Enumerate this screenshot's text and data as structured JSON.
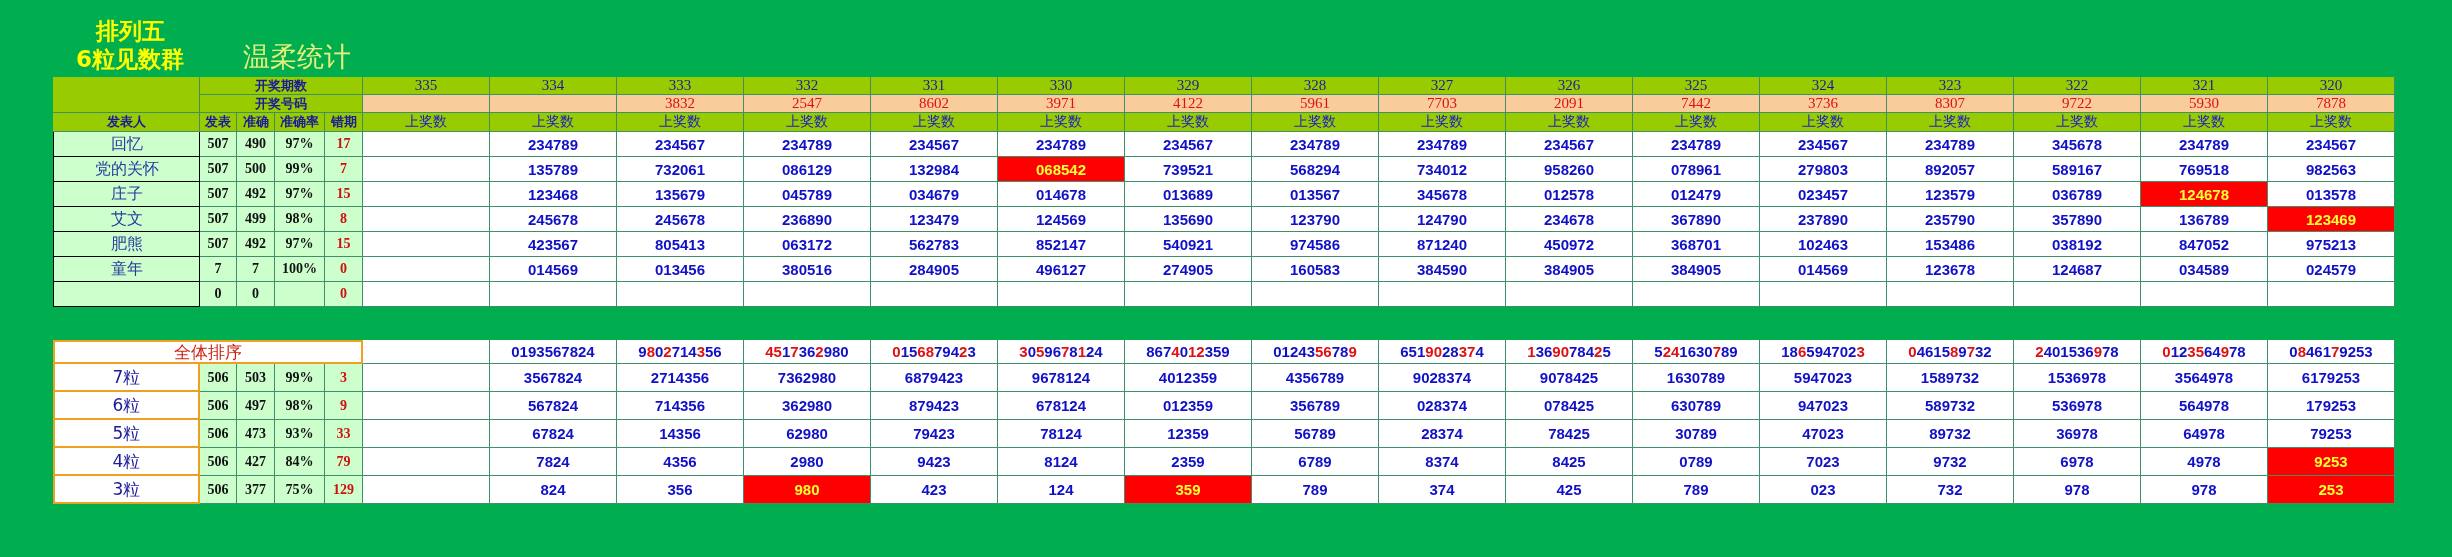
{
  "title": "排列五",
  "subtitle": "6粒见数群",
  "caption": "温柔统计",
  "header": {
    "period_label": "开奖期数",
    "draw_label": "开奖号码",
    "columns": [
      "发表人",
      "发表",
      "准确",
      "准确率",
      "错期"
    ]
  },
  "periods": [
    {
      "period": "335",
      "label": "上奖数"
    },
    {
      "period": "334",
      "label": "上奖数"
    },
    {
      "period": "333",
      "draw": "3832",
      "label": "上奖数"
    },
    {
      "period": "332",
      "draw": "2547",
      "label": "上奖数"
    },
    {
      "period": "331",
      "draw": "8602",
      "label": "上奖数"
    },
    {
      "period": "330",
      "draw": "3971",
      "label": "上奖数"
    },
    {
      "period": "329",
      "draw": "4122",
      "label": "上奖数"
    },
    {
      "period": "328",
      "draw": "5961",
      "label": "上奖数"
    },
    {
      "period": "327",
      "draw": "7703",
      "label": "上奖数"
    },
    {
      "period": "326",
      "draw": "2091",
      "label": "上奖数"
    },
    {
      "period": "325",
      "draw": "7442",
      "label": "上奖数"
    },
    {
      "period": "324",
      "draw": "3736",
      "label": "上奖数"
    },
    {
      "period": "323",
      "draw": "8307",
      "label": "上奖数"
    },
    {
      "period": "322",
      "draw": "9722",
      "label": "上奖数"
    },
    {
      "period": "321",
      "draw": "5930",
      "label": "上奖数"
    },
    {
      "period": "320",
      "draw": "7878",
      "label": "上奖数"
    }
  ],
  "experts": [
    {
      "name": "回忆",
      "posted": "507",
      "correct": "490",
      "rate": "97%",
      "misses": "17",
      "cells": [
        null,
        {
          "value": "234789",
          "miss": false
        },
        {
          "value": "234567",
          "miss": false
        },
        {
          "value": "234789",
          "miss": false
        },
        {
          "value": "234567",
          "miss": false
        },
        {
          "value": "234789",
          "miss": false
        },
        {
          "value": "234567",
          "miss": false
        },
        {
          "value": "234789",
          "miss": false
        },
        {
          "value": "234789",
          "miss": false
        },
        {
          "value": "234567",
          "miss": false
        },
        {
          "value": "234789",
          "miss": false
        },
        {
          "value": "234567",
          "miss": false
        },
        {
          "value": "234789",
          "miss": false
        },
        {
          "value": "345678",
          "miss": false
        },
        {
          "value": "234789",
          "miss": false
        },
        {
          "value": "234567",
          "miss": false
        }
      ]
    },
    {
      "name": "党的关怀",
      "posted": "507",
      "correct": "500",
      "rate": "99%",
      "misses": "7",
      "cells": [
        null,
        {
          "value": "135789",
          "miss": false
        },
        {
          "value": "732061",
          "miss": false
        },
        {
          "value": "086129",
          "miss": false
        },
        {
          "value": "132984",
          "miss": false
        },
        {
          "value": "068542",
          "miss": true
        },
        {
          "value": "739521",
          "miss": false
        },
        {
          "value": "568294",
          "miss": false
        },
        {
          "value": "734012",
          "miss": false
        },
        {
          "value": "958260",
          "miss": false
        },
        {
          "value": "078961",
          "miss": false
        },
        {
          "value": "279803",
          "miss": false
        },
        {
          "value": "892057",
          "miss": false
        },
        {
          "value": "589167",
          "miss": false
        },
        {
          "value": "769518",
          "miss": false
        },
        {
          "value": "982563",
          "miss": false
        }
      ]
    },
    {
      "name": "庄子",
      "posted": "507",
      "correct": "492",
      "rate": "97%",
      "misses": "15",
      "cells": [
        null,
        {
          "value": "123468",
          "miss": false
        },
        {
          "value": "135679",
          "miss": false
        },
        {
          "value": "045789",
          "miss": false
        },
        {
          "value": "034679",
          "miss": false
        },
        {
          "value": "014678",
          "miss": false
        },
        {
          "value": "013689",
          "miss": false
        },
        {
          "value": "013567",
          "miss": false
        },
        {
          "value": "345678",
          "miss": false
        },
        {
          "value": "012578",
          "miss": false
        },
        {
          "value": "012479",
          "miss": false
        },
        {
          "value": "023457",
          "miss": false
        },
        {
          "value": "123579",
          "miss": false
        },
        {
          "value": "036789",
          "miss": false
        },
        {
          "value": "124678",
          "miss": true
        },
        {
          "value": "013578",
          "miss": false
        }
      ]
    },
    {
      "name": "艾文",
      "posted": "507",
      "correct": "499",
      "rate": "98%",
      "misses": "8",
      "cells": [
        null,
        {
          "value": "245678",
          "miss": false
        },
        {
          "value": "245678",
          "miss": false
        },
        {
          "value": "236890",
          "miss": false
        },
        {
          "value": "123479",
          "miss": false
        },
        {
          "value": "124569",
          "miss": false
        },
        {
          "value": "135690",
          "miss": false
        },
        {
          "value": "123790",
          "miss": false
        },
        {
          "value": "124790",
          "miss": false
        },
        {
          "value": "234678",
          "miss": false
        },
        {
          "value": "367890",
          "miss": false
        },
        {
          "value": "237890",
          "miss": false
        },
        {
          "value": "235790",
          "miss": false
        },
        {
          "value": "357890",
          "miss": false
        },
        {
          "value": "136789",
          "miss": false
        },
        {
          "value": "123469",
          "miss": true
        }
      ]
    },
    {
      "name": "肥熊",
      "posted": "507",
      "correct": "492",
      "rate": "97%",
      "misses": "15",
      "cells": [
        null,
        {
          "value": "423567",
          "miss": false
        },
        {
          "value": "805413",
          "miss": false
        },
        {
          "value": "063172",
          "miss": false
        },
        {
          "value": "562783",
          "miss": false
        },
        {
          "value": "852147",
          "miss": false
        },
        {
          "value": "540921",
          "miss": false
        },
        {
          "value": "974586",
          "miss": false
        },
        {
          "value": "871240",
          "miss": false
        },
        {
          "value": "450972",
          "miss": false
        },
        {
          "value": "368701",
          "miss": false
        },
        {
          "value": "102463",
          "miss": false
        },
        {
          "value": "153486",
          "miss": false
        },
        {
          "value": "038192",
          "miss": false
        },
        {
          "value": "847052",
          "miss": false
        },
        {
          "value": "975213",
          "miss": false
        }
      ]
    },
    {
      "name": "童年",
      "posted": "7",
      "correct": "7",
      "rate": "100%",
      "misses": "0",
      "cells": [
        null,
        {
          "value": "014569",
          "miss": false
        },
        {
          "value": "013456",
          "miss": false
        },
        {
          "value": "380516",
          "miss": false
        },
        {
          "value": "284905",
          "miss": false
        },
        {
          "value": "496127",
          "miss": false
        },
        {
          "value": "274905",
          "miss": false
        },
        {
          "value": "160583",
          "miss": false
        },
        {
          "value": "384590",
          "miss": false
        },
        {
          "value": "384905",
          "miss": false
        },
        {
          "value": "384905",
          "miss": false
        },
        {
          "value": "014569",
          "miss": false
        },
        {
          "value": "123678",
          "miss": false
        },
        {
          "value": "124687",
          "miss": false
        },
        {
          "value": "034589",
          "miss": false
        },
        {
          "value": "024579",
          "miss": false
        }
      ]
    },
    {
      "posted": "0",
      "correct": "0",
      "misses": "0",
      "cells": [
        null,
        null,
        null,
        null,
        null,
        null,
        null,
        null,
        null,
        null,
        null,
        null,
        null,
        null,
        null,
        null
      ]
    }
  ],
  "ranking": {
    "label": "全体排序",
    "cells": [
      null,
      [
        {
          "text": "0193567824",
          "hit": false
        }
      ],
      [
        {
          "text": "9",
          "hit": false
        },
        {
          "text": "8",
          "hit": true
        },
        {
          "text": "0",
          "hit": false
        },
        {
          "text": "2",
          "hit": true
        },
        {
          "text": "714",
          "hit": false
        },
        {
          "text": "3",
          "hit": true
        },
        {
          "text": "56",
          "hit": false
        }
      ],
      [
        {
          "text": "45",
          "hit": true
        },
        {
          "text": "1",
          "hit": false
        },
        {
          "text": "7",
          "hit": true
        },
        {
          "text": "36",
          "hit": false
        },
        {
          "text": "2",
          "hit": true
        },
        {
          "text": "980",
          "hit": false
        }
      ],
      [
        {
          "text": "0",
          "hit": true
        },
        {
          "text": "15",
          "hit": false
        },
        {
          "text": "68",
          "hit": true
        },
        {
          "text": "794",
          "hit": false
        },
        {
          "text": "2",
          "hit": true
        },
        {
          "text": "3",
          "hit": false
        }
      ],
      [
        {
          "text": "3",
          "hit": true
        },
        {
          "text": "0",
          "hit": false
        },
        {
          "text": "5",
          "hit": true
        },
        {
          "text": "96",
          "hit": false
        },
        {
          "text": "7",
          "hit": true
        },
        {
          "text": "8",
          "hit": false
        },
        {
          "text": "1",
          "hit": true
        },
        {
          "text": "24",
          "hit": false
        }
      ],
      [
        {
          "text": "867",
          "hit": false
        },
        {
          "text": "4",
          "hit": true
        },
        {
          "text": "0",
          "hit": false
        },
        {
          "text": "12",
          "hit": true
        },
        {
          "text": "359",
          "hit": false
        }
      ],
      [
        {
          "text": "01243",
          "hit": false
        },
        {
          "text": "56",
          "hit": true
        },
        {
          "text": "78",
          "hit": false
        },
        {
          "text": "9",
          "hit": true
        }
      ],
      [
        {
          "text": "651",
          "hit": false
        },
        {
          "text": "90",
          "hit": true
        },
        {
          "text": "28",
          "hit": false
        },
        {
          "text": "37",
          "hit": true
        },
        {
          "text": "4",
          "hit": false
        }
      ],
      [
        {
          "text": "1",
          "hit": true
        },
        {
          "text": "36",
          "hit": false
        },
        {
          "text": "90",
          "hit": true
        },
        {
          "text": "784",
          "hit": false
        },
        {
          "text": "2",
          "hit": true
        },
        {
          "text": "5",
          "hit": false
        }
      ],
      [
        {
          "text": "5",
          "hit": false
        },
        {
          "text": "24",
          "hit": true
        },
        {
          "text": "1630",
          "hit": false
        },
        {
          "text": "7",
          "hit": true
        },
        {
          "text": "89",
          "hit": false
        }
      ],
      [
        {
          "text": "18",
          "hit": false
        },
        {
          "text": "6",
          "hit": true
        },
        {
          "text": "594702",
          "hit": false
        },
        {
          "text": "3",
          "hit": true
        }
      ],
      [
        {
          "text": "0",
          "hit": true
        },
        {
          "text": "4615",
          "hit": false
        },
        {
          "text": "8",
          "hit": true
        },
        {
          "text": "9",
          "hit": false
        },
        {
          "text": "7",
          "hit": true
        },
        {
          "text": "32",
          "hit": false
        }
      ],
      [
        {
          "text": "2",
          "hit": true
        },
        {
          "text": "401536",
          "hit": false
        },
        {
          "text": "9",
          "hit": true
        },
        {
          "text": "78",
          "hit": false
        }
      ],
      [
        {
          "text": "0",
          "hit": true
        },
        {
          "text": "12",
          "hit": false
        },
        {
          "text": "35",
          "hit": true
        },
        {
          "text": "64",
          "hit": false
        },
        {
          "text": "9",
          "hit": true
        },
        {
          "text": "78",
          "hit": false
        }
      ],
      [
        {
          "text": "0",
          "hit": false
        },
        {
          "text": "8",
          "hit": true
        },
        {
          "text": "461",
          "hit": false
        },
        {
          "text": "7",
          "hit": true
        },
        {
          "text": "9253",
          "hit": false
        }
      ]
    ]
  },
  "groups": [
    {
      "name": "7粒",
      "posted": "506",
      "correct": "503",
      "rate": "99%",
      "misses": "3",
      "cells": [
        null,
        {
          "value": "3567824",
          "miss": false
        },
        {
          "value": "2714356",
          "miss": false
        },
        {
          "value": "7362980",
          "miss": false
        },
        {
          "value": "6879423",
          "miss": false
        },
        {
          "value": "9678124",
          "miss": false
        },
        {
          "value": "4012359",
          "miss": false
        },
        {
          "value": "4356789",
          "miss": false
        },
        {
          "value": "9028374",
          "miss": false
        },
        {
          "value": "9078425",
          "miss": false
        },
        {
          "value": "1630789",
          "miss": false
        },
        {
          "value": "5947023",
          "miss": false
        },
        {
          "value": "1589732",
          "miss": false
        },
        {
          "value": "1536978",
          "miss": false
        },
        {
          "value": "3564978",
          "miss": false
        },
        {
          "value": "6179253",
          "miss": false
        }
      ]
    },
    {
      "name": "6粒",
      "posted": "506",
      "correct": "497",
      "rate": "98%",
      "misses": "9",
      "cells": [
        null,
        {
          "value": "567824",
          "miss": false
        },
        {
          "value": "714356",
          "miss": false
        },
        {
          "value": "362980",
          "miss": false
        },
        {
          "value": "879423",
          "miss": false
        },
        {
          "value": "678124",
          "miss": false
        },
        {
          "value": "012359",
          "miss": false
        },
        {
          "value": "356789",
          "miss": false
        },
        {
          "value": "028374",
          "miss": false
        },
        {
          "value": "078425",
          "miss": false
        },
        {
          "value": "630789",
          "miss": false
        },
        {
          "value": "947023",
          "miss": false
        },
        {
          "value": "589732",
          "miss": false
        },
        {
          "value": "536978",
          "miss": false
        },
        {
          "value": "564978",
          "miss": false
        },
        {
          "value": "179253",
          "miss": false
        }
      ]
    },
    {
      "name": "5粒",
      "posted": "506",
      "correct": "473",
      "rate": "93%",
      "misses": "33",
      "cells": [
        null,
        {
          "value": "67824",
          "miss": false
        },
        {
          "value": "14356",
          "miss": false
        },
        {
          "value": "62980",
          "miss": false
        },
        {
          "value": "79423",
          "miss": false
        },
        {
          "value": "78124",
          "miss": false
        },
        {
          "value": "12359",
          "miss": false
        },
        {
          "value": "56789",
          "miss": false
        },
        {
          "value": "28374",
          "miss": false
        },
        {
          "value": "78425",
          "miss": false
        },
        {
          "value": "30789",
          "miss": false
        },
        {
          "value": "47023",
          "miss": false
        },
        {
          "value": "89732",
          "miss": false
        },
        {
          "value": "36978",
          "miss": false
        },
        {
          "value": "64978",
          "miss": false
        },
        {
          "value": "79253",
          "miss": false
        }
      ]
    },
    {
      "name": "4粒",
      "posted": "506",
      "correct": "427",
      "rate": "84%",
      "misses": "79",
      "cells": [
        null,
        {
          "value": "7824",
          "miss": false
        },
        {
          "value": "4356",
          "miss": false
        },
        {
          "value": "2980",
          "miss": false
        },
        {
          "value": "9423",
          "miss": false
        },
        {
          "value": "8124",
          "miss": false
        },
        {
          "value": "2359",
          "miss": false
        },
        {
          "value": "6789",
          "miss": false
        },
        {
          "value": "8374",
          "miss": false
        },
        {
          "value": "8425",
          "miss": false
        },
        {
          "value": "0789",
          "miss": false
        },
        {
          "value": "7023",
          "miss": false
        },
        {
          "value": "9732",
          "miss": false
        },
        {
          "value": "6978",
          "miss": false
        },
        {
          "value": "4978",
          "miss": false
        },
        {
          "value": "9253",
          "miss": true
        }
      ]
    },
    {
      "name": "3粒",
      "posted": "506",
      "correct": "377",
      "rate": "75%",
      "misses": "129",
      "cells": [
        null,
        {
          "value": "824",
          "miss": false
        },
        {
          "value": "356",
          "miss": false
        },
        {
          "value": "980",
          "miss": true
        },
        {
          "value": "423",
          "miss": false
        },
        {
          "value": "124",
          "miss": false
        },
        {
          "value": "359",
          "miss": true
        },
        {
          "value": "789",
          "miss": false
        },
        {
          "value": "374",
          "miss": false
        },
        {
          "value": "425",
          "miss": false
        },
        {
          "value": "789",
          "miss": false
        },
        {
          "value": "023",
          "miss": false
        },
        {
          "value": "732",
          "miss": false
        },
        {
          "value": "978",
          "miss": false
        },
        {
          "value": "978",
          "miss": false
        },
        {
          "value": "253",
          "miss": true
        }
      ]
    }
  ]
}
